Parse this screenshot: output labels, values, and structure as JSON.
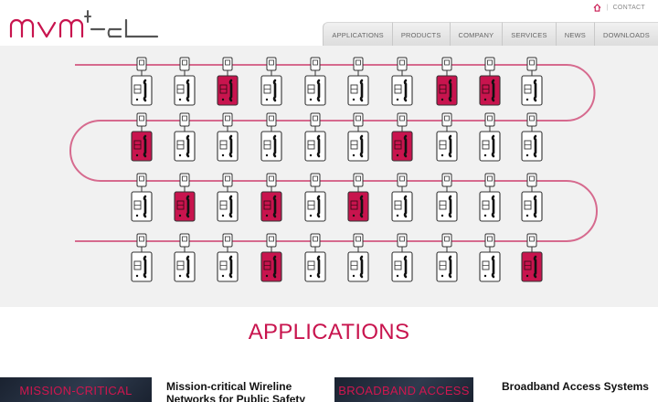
{
  "brand": {
    "name": "mvm-tel",
    "accent": "#c8144e"
  },
  "toplinks": {
    "home_icon": "home-icon",
    "contact": "CONTACT"
  },
  "nav": [
    {
      "label": "APPLICATIONS"
    },
    {
      "label": "PRODUCTS"
    },
    {
      "label": "COMPANY"
    },
    {
      "label": "SERVICES"
    },
    {
      "label": "NEWS"
    },
    {
      "label": "DOWNLOADS"
    }
  ],
  "hero": {
    "pattern_rows": [
      [
        0,
        0,
        1,
        0,
        0,
        0,
        0,
        1,
        1,
        0
      ],
      [
        1,
        0,
        0,
        0,
        0,
        0,
        1,
        0,
        0,
        0
      ],
      [
        0,
        1,
        0,
        1,
        0,
        1,
        0,
        0,
        0,
        0
      ],
      [
        0,
        0,
        0,
        1,
        0,
        0,
        0,
        0,
        0,
        1
      ]
    ]
  },
  "section": {
    "title": "APPLICATIONS"
  },
  "cards": [
    {
      "overlay": "MISSION-CRITICAL",
      "title": "Mission-critical Wireline Networks for Public Safety"
    },
    {
      "overlay": "BROADBAND ACCESS",
      "title": "Broadband Access Systems"
    }
  ]
}
